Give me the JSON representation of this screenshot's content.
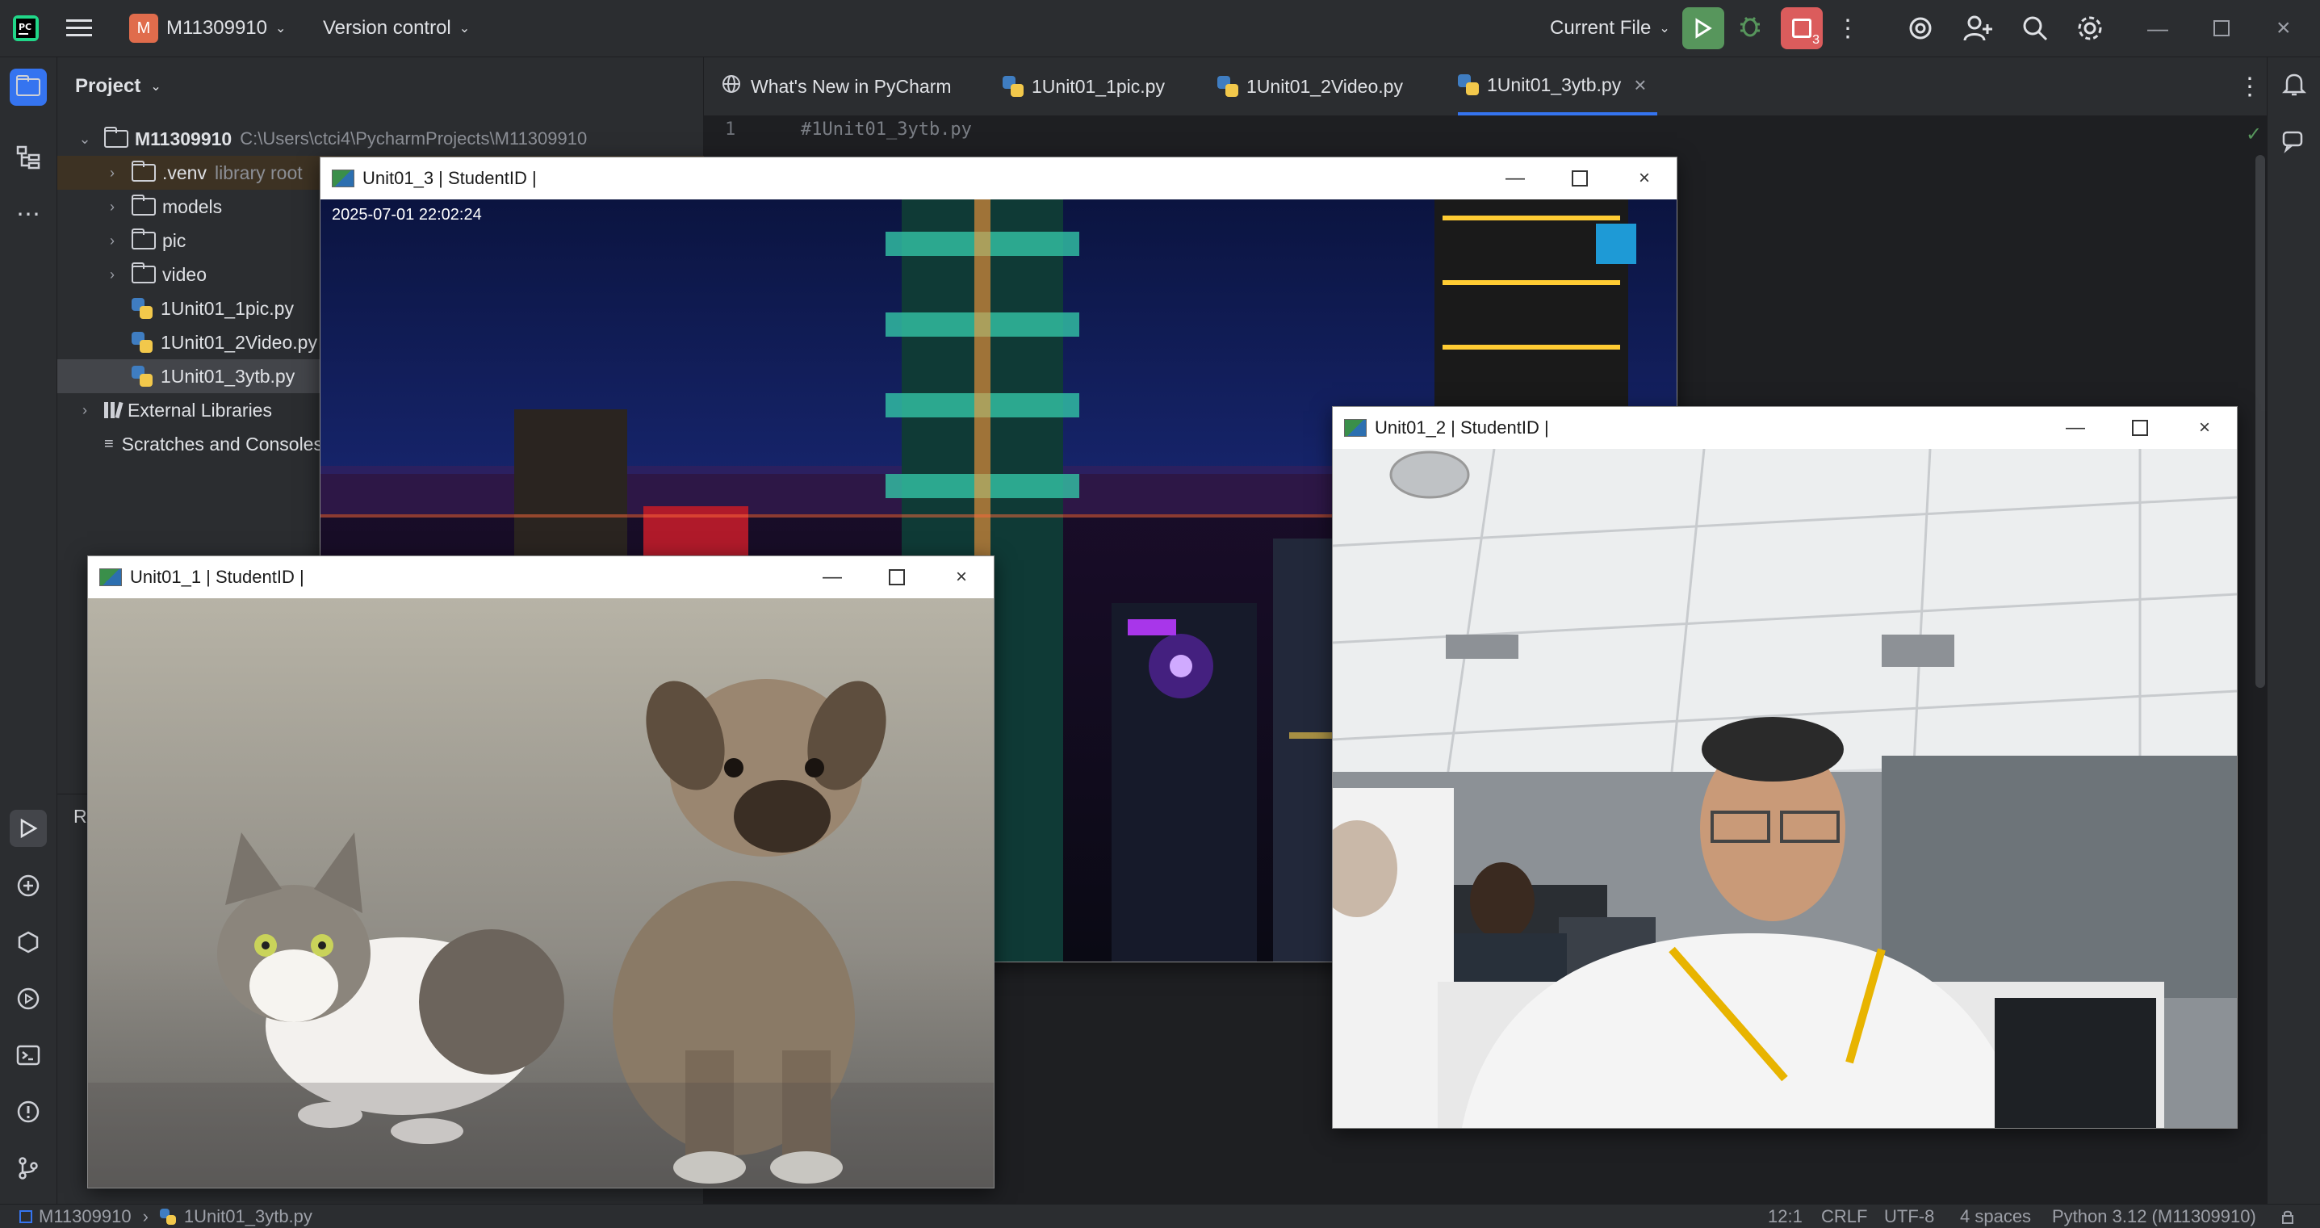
{
  "topbar": {
    "project_badge": "M",
    "project_name": "M11309910",
    "vcs": "Version control",
    "run_config": "Current File",
    "run_badge": "3"
  },
  "project_panel": {
    "title": "Project",
    "root": {
      "name": "M11309910",
      "path": "C:\\Users\\ctci4\\PycharmProjects\\M11309910"
    },
    "items": [
      {
        "name": ".venv",
        "hint": "library root"
      },
      {
        "name": "models"
      },
      {
        "name": "pic"
      },
      {
        "name": "video"
      },
      {
        "name": "1Unit01_1pic.py"
      },
      {
        "name": "1Unit01_2Video.py"
      },
      {
        "name": "1Unit01_3ytb.py"
      }
    ],
    "external": "External Libraries",
    "scratches": "Scratches and Consoles"
  },
  "tabs": [
    {
      "label": "What's New in PyCharm"
    },
    {
      "label": "1Unit01_1pic.py"
    },
    {
      "label": "1Unit01_2Video.py"
    },
    {
      "label": "1Unit01_3ytb.py",
      "active": true
    }
  ],
  "editor": {
    "line_number": "1",
    "code": "#1Unit01_3ytb.py"
  },
  "run_panel_label": "R",
  "windows": {
    "win3": {
      "title": "Unit01_3 | StudentID |",
      "timestamp": "2025-07-01 22:02:24"
    },
    "win2": {
      "title": "Unit01_2 | StudentID |"
    },
    "win1": {
      "title": "Unit01_1 | StudentID |"
    }
  },
  "statusbar": {
    "breadcrumb_root": "M11309910",
    "breadcrumb_file": "1Unit01_3ytb.py",
    "position": "12:1",
    "line_ending": "CRLF",
    "encoding": "UTF-8",
    "indent": "4 spaces",
    "interpreter": "Python 3.12 (M11309910)"
  },
  "colors": {
    "accent": "#3574f0",
    "run_green": "#57965c",
    "stop_red": "#db5c5c",
    "project_badge": "#e06c4c"
  }
}
